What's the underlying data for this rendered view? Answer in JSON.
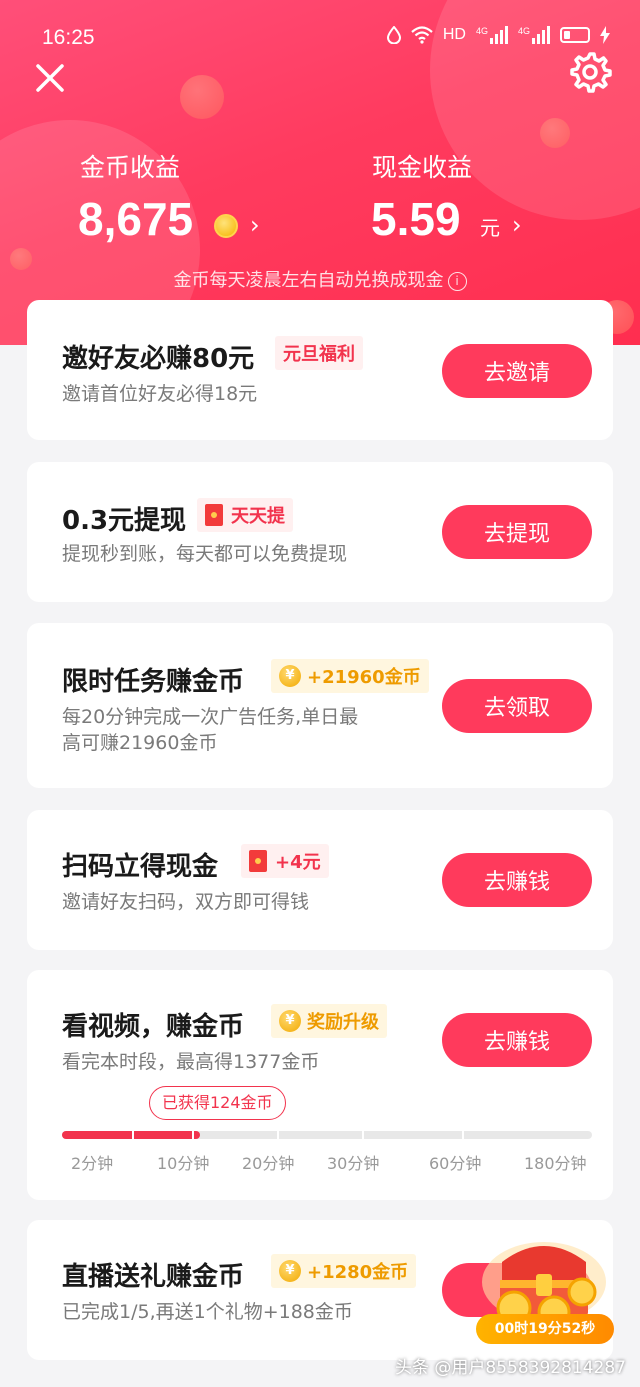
{
  "status_bar": {
    "time": "16:25",
    "network_label": "HD",
    "net1": "4G",
    "net2": "4G"
  },
  "earnings": {
    "coin_label": "金币收益",
    "coin_value": "8,675",
    "cash_label": "现金收益",
    "cash_value": "5.59",
    "cash_unit": "元",
    "note": "金币每天凌晨左右自动兑换成现金"
  },
  "tasks": [
    {
      "title": "邀好友必赚80元",
      "tag": "元旦福利",
      "sub": "邀请首位好友必得18元",
      "button": "去邀请"
    },
    {
      "title": "0.3元提现",
      "tag": "天天提",
      "sub": "提现秒到账，每天都可以免费提现",
      "button": "去提现"
    },
    {
      "title": "限时任务赚金币",
      "tag": "+21960金币",
      "sub1": "每20分钟完成一次广告任务,单日最",
      "sub2": "高可赚21960金币",
      "button": "去领取"
    },
    {
      "title": "扫码立得现金",
      "tag": "+4元",
      "sub": "邀请好友扫码，双方即可得钱",
      "button": "去赚钱"
    },
    {
      "title": "看视频，赚金币",
      "tag": "奖励升级",
      "sub": "看完本时段，最高得1377金币",
      "button": "去赚钱",
      "earned": "已获得124金币",
      "progress_labels": [
        "2分钟",
        "10分钟",
        "20分钟",
        "30分钟",
        "60分钟",
        "180分钟"
      ],
      "progress_fraction": 0.26
    },
    {
      "title": "直播送礼赚金币",
      "tag": "+1280金币",
      "sub": "已完成1/5,再送1个礼物+188金币"
    }
  ],
  "chest": {
    "countdown": "00时19分52秒"
  },
  "watermark": "头条 @用户8558392814287",
  "icons": {
    "close": "close-icon",
    "settings": "gear-icon",
    "info": "info-icon",
    "coin": "coin-icon",
    "envelope": "red-envelope-icon"
  },
  "colors": {
    "accent": "#ff3a5c",
    "gold": "#ee9b00"
  }
}
